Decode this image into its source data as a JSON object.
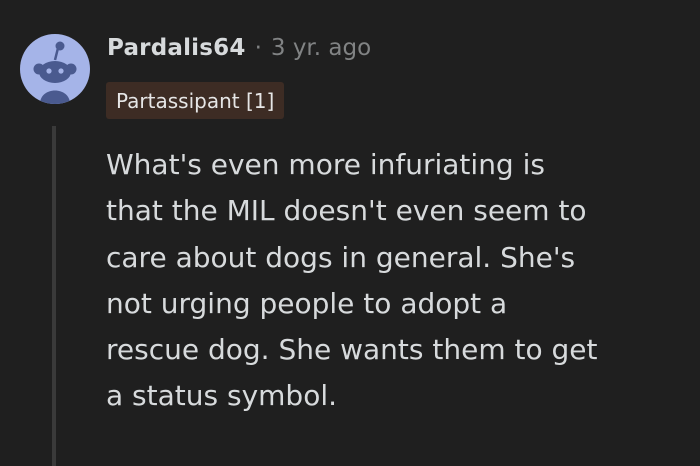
{
  "comment": {
    "author": "Pardalis64",
    "separator": "·",
    "age": "3 yr. ago",
    "flair": "Partassipant [1]",
    "avatar_icon": "reddit-snoo-avatar-icon",
    "lines": [
      "What's even more infuriating is",
      "that the MIL doesn't even seem to",
      "care about dogs in general. She's",
      "not urging people to adopt a",
      "rescue dog. She wants them to get",
      "a status symbol."
    ]
  },
  "colors": {
    "background": "#1f1f1f",
    "avatar_bg": "#a5b4e8",
    "flair_bg": "#3d2c24",
    "text": "#d7dadc",
    "muted": "#818384"
  }
}
